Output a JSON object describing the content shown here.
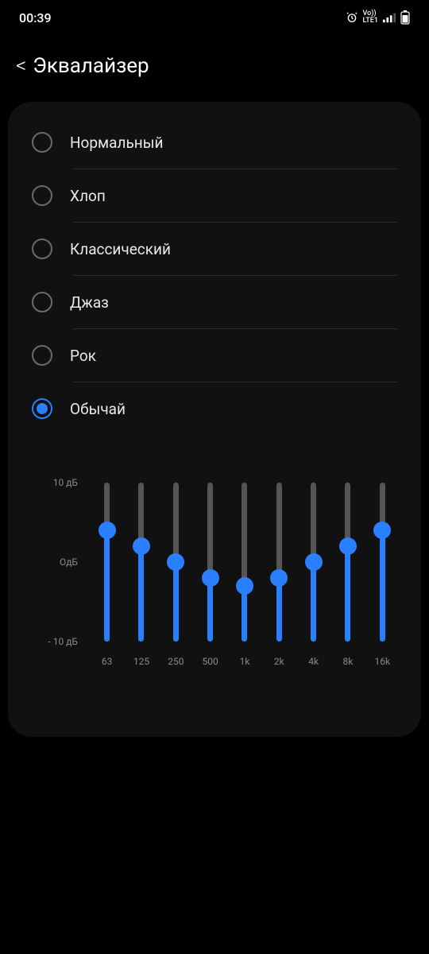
{
  "status": {
    "time": "00:39",
    "indicators": {
      "alarm": true,
      "volte": "Vo))",
      "network": "LTE1",
      "signal": 3,
      "battery": 70
    }
  },
  "header": {
    "back_symbol": "<",
    "title": "Эквалайзер"
  },
  "presets": [
    {
      "id": "normal",
      "label": "Нормальный",
      "selected": false
    },
    {
      "id": "pop",
      "label": "Хлоп",
      "selected": false
    },
    {
      "id": "classic",
      "label": "Классический",
      "selected": false
    },
    {
      "id": "jazz",
      "label": "Джаз",
      "selected": false
    },
    {
      "id": "rock",
      "label": "Рок",
      "selected": false
    },
    {
      "id": "custom",
      "label": "Обычай",
      "selected": true
    }
  ],
  "chart_data": {
    "type": "bar",
    "title": "",
    "xlabel": "",
    "ylabel": "",
    "ylim": [
      -10,
      10
    ],
    "categories": [
      "63",
      "125",
      "250",
      "500",
      "1k",
      "2k",
      "4k",
      "8k",
      "16k"
    ],
    "values": [
      4,
      2,
      0,
      -2,
      -3,
      -2,
      0,
      2,
      4
    ],
    "y_tick_labels": [
      "10 дБ",
      "OдБ",
      "- 10 дБ"
    ]
  },
  "colors": {
    "accent": "#2a7fff",
    "panel": "#111111",
    "track": "#555555"
  }
}
